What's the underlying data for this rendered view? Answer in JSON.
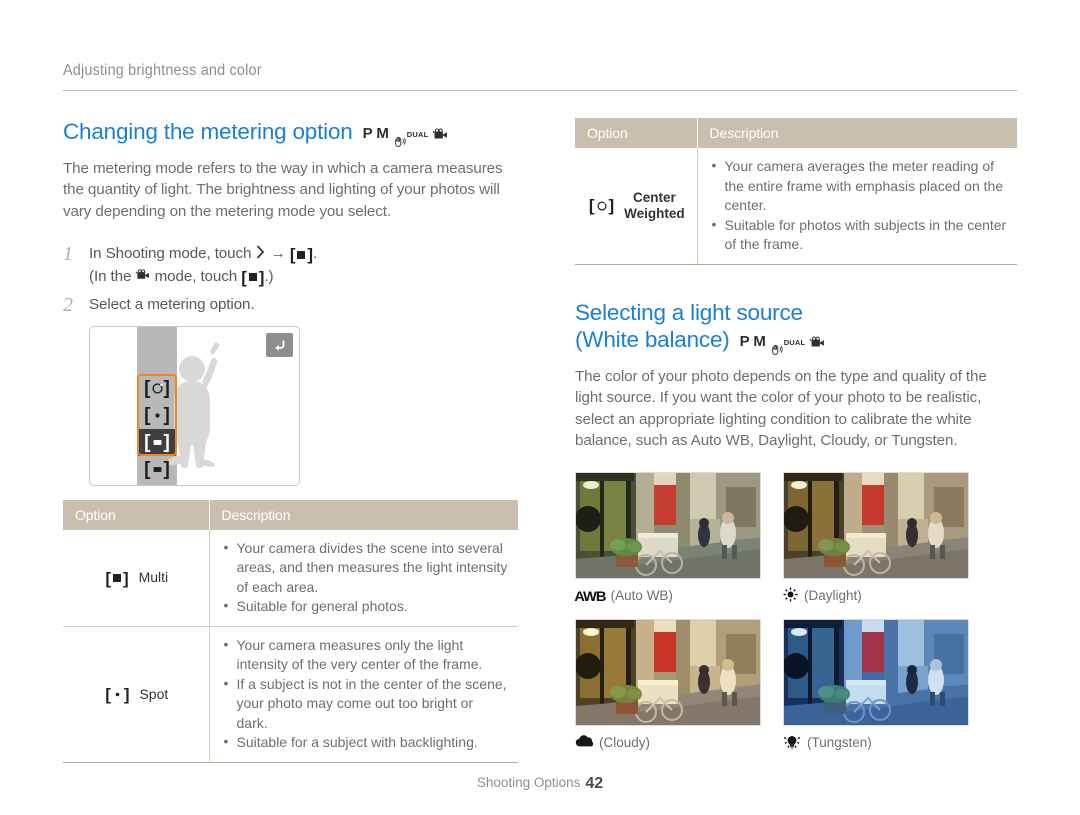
{
  "breadcrumb": "Adjusting brightness and color",
  "metering": {
    "heading": "Changing the metering option",
    "modes": [
      "P",
      "M",
      "dual-is-icon",
      "DUAL",
      "movie-icon"
    ],
    "intro": "The metering mode refers to the way in which a camera measures the quantity of light. The brightness and lighting of your photos will vary depending on the metering mode you select.",
    "steps": [
      {
        "num": "1",
        "line1_a": "In Shooting mode, touch",
        "line1_arrow": "→",
        "line1_b": ".",
        "line2_a": "(In the",
        "line2_b": "mode, touch",
        "line2_c": ".)"
      },
      {
        "num": "2",
        "line1_a": "Select a metering option."
      }
    ],
    "screen": {
      "back_button": "back-icon",
      "options": [
        "center-weighted-icon",
        "spot-icon",
        "multi-icon-selected",
        "multi-icon"
      ],
      "selected_index": 2
    }
  },
  "table_left": {
    "headers": [
      "Option",
      "Description"
    ],
    "rows": [
      {
        "icon": "multi-metering-icon",
        "label": "Multi",
        "bullets": [
          "Your camera divides the scene into several areas, and then measures the light intensity of each area.",
          "Suitable for general photos."
        ]
      },
      {
        "icon": "spot-metering-icon",
        "label": "Spot",
        "bullets": [
          "Your camera measures only the light intensity of the very center of the frame.",
          "If a subject is not in the center of the scene, your photo may come out too bright or dark.",
          "Suitable for a subject with backlighting."
        ]
      }
    ]
  },
  "table_right": {
    "headers": [
      "Option",
      "Description"
    ],
    "rows": [
      {
        "icon": "center-weighted-metering-icon",
        "label_line1": "Center",
        "label_line2": "Weighted",
        "bullets": [
          "Your camera averages the meter reading of the entire frame with emphasis placed on the center.",
          "Suitable for photos with subjects in the center of the frame."
        ]
      }
    ]
  },
  "white_balance": {
    "heading_line1": "Selecting a light source",
    "heading_line2": "(White balance)",
    "modes": [
      "P",
      "M",
      "dual-is-icon",
      "DUAL",
      "movie-icon"
    ],
    "intro": "The color of your photo depends on the type and quality of the light source. If you want the color of your photo to be realistic, select an appropriate lighting condition to calibrate the white balance, such as Auto WB, Daylight, Cloudy, or Tungsten.",
    "samples": [
      {
        "icon": "awb-icon",
        "mark": "AWB",
        "caption": "(Auto WB)"
      },
      {
        "icon": "daylight-icon",
        "mark": "",
        "caption": "(Daylight)"
      },
      {
        "icon": "cloudy-icon",
        "mark": "",
        "caption": "(Cloudy)"
      },
      {
        "icon": "tungsten-icon",
        "mark": "",
        "caption": "(Tungsten)"
      }
    ]
  },
  "footer": {
    "label": "Shooting Options",
    "page": "42"
  }
}
